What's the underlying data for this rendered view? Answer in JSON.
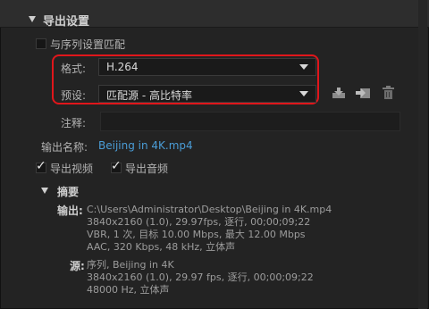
{
  "section": {
    "title": "导出设置"
  },
  "match_sequence": {
    "label": "与序列设置匹配",
    "checked": false
  },
  "format": {
    "label": "格式:",
    "value": "H.264"
  },
  "preset": {
    "label": "预设:",
    "value": "匹配源 - 高比特率"
  },
  "preset_icons": [
    "save-preset-icon",
    "import-preset-icon",
    "delete-preset-icon"
  ],
  "notes": {
    "label": "注释:",
    "value": ""
  },
  "output_name": {
    "label": "输出名称:",
    "value": "Beijing in 4K.mp4"
  },
  "export_video": {
    "label": "导出视频",
    "checked": true
  },
  "export_audio": {
    "label": "导出音频",
    "checked": true
  },
  "summary": {
    "title": "摘要",
    "output_label": "输出:",
    "output_lines": [
      "C:\\Users\\Administrator\\Desktop\\Beijing in 4K.mp4",
      "3840x2160 (1.0), 29.97fps, 逐行, 00;00;09;22",
      "VBR, 1 次, 目标 10.00 Mbps, 最大 12.00 Mbps",
      "AAC, 320 Kbps, 48 kHz, 立体声"
    ],
    "source_label": "源:",
    "source_lines": [
      "序列, Beijing in 4K",
      "3840x2160 (1.0), 29.97 fps, 逐行, 00;00;09;22",
      "48000 Hz, 立体声"
    ]
  },
  "colors": {
    "highlight": "#e0161b",
    "link": "#4a9cd6",
    "background": "#232323"
  }
}
